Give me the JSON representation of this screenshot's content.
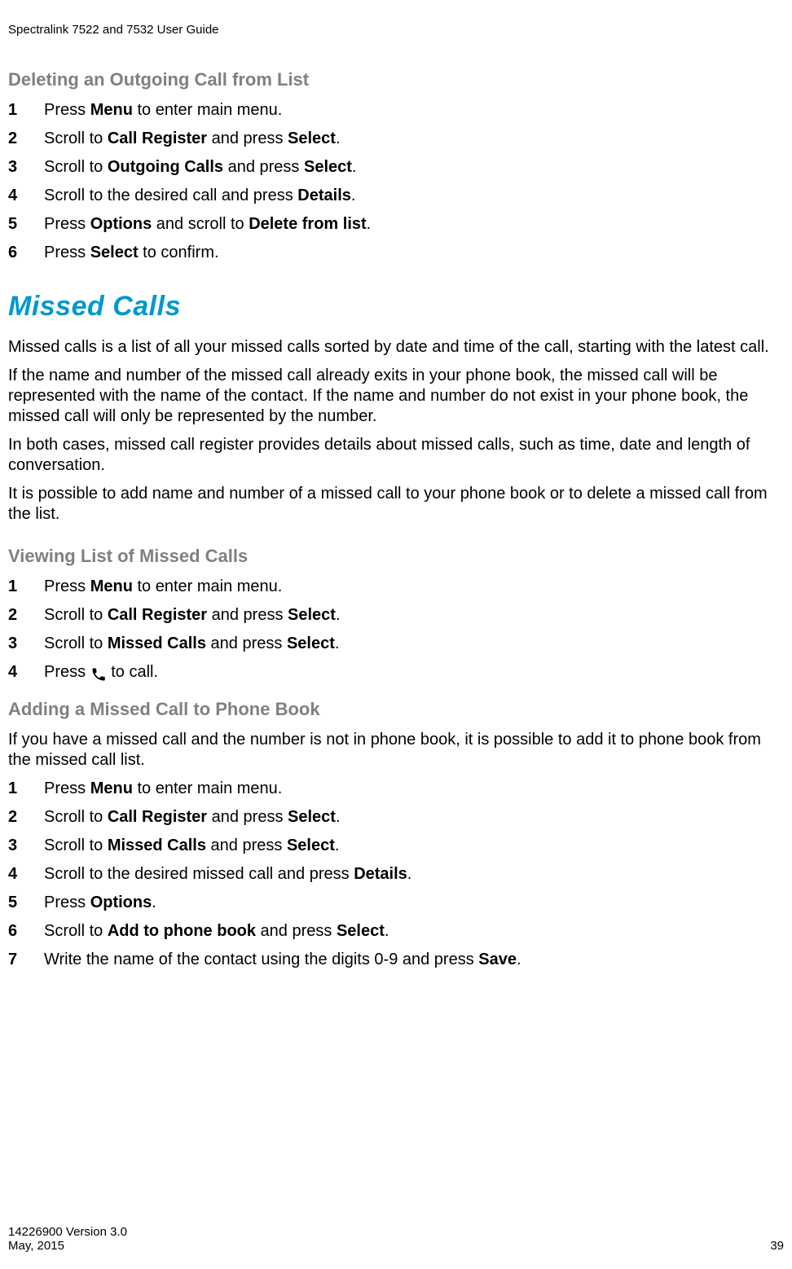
{
  "header": {
    "title": "Spectralink 7522 and 7532 User Guide"
  },
  "sections": {
    "delete_outgoing": {
      "heading": "Deleting an Outgoing Call from List",
      "steps": [
        {
          "pre": "Press ",
          "b1": "Menu",
          "mid": " to enter main menu.",
          "b2": "",
          "post": ""
        },
        {
          "pre": "Scroll to ",
          "b1": "Call Register",
          "mid": " and press ",
          "b2": "Select",
          "post": "."
        },
        {
          "pre": "Scroll to ",
          "b1": "Outgoing Calls",
          "mid": " and press ",
          "b2": "Select",
          "post": "."
        },
        {
          "pre": "Scroll to the desired call and press ",
          "b1": "Details",
          "mid": ".",
          "b2": "",
          "post": ""
        },
        {
          "pre": "Press ",
          "b1": "Options",
          "mid": " and scroll to ",
          "b2": "Delete from list",
          "post": "."
        },
        {
          "pre": "Press ",
          "b1": "Select",
          "mid": " to confirm.",
          "b2": "",
          "post": ""
        }
      ]
    },
    "missed_calls": {
      "chapter": "Missed Calls",
      "para1": "Missed calls is a list of all your missed calls sorted by date and time of the call, starting with the latest call.",
      "para2": "If the name and number of the missed call already exits in your phone book, the missed call will be represented with the name of the contact. If the name and number do not exist in your phone book, the missed call will only be represented by the number.",
      "para3": "In both cases, missed call register provides details about missed calls, such as time, date and length of conversation.",
      "para4": "It is possible to add name and number of a missed call to your phone book or to delete a missed call from the list."
    },
    "view_missed": {
      "heading": "Viewing List of Missed Calls",
      "steps": [
        {
          "pre": "Press ",
          "b1": "Menu",
          "mid": " to enter main menu.",
          "b2": "",
          "post": ""
        },
        {
          "pre": "Scroll to ",
          "b1": "Call Register",
          "mid": " and press ",
          "b2": "Select",
          "post": "."
        },
        {
          "pre": "Scroll to ",
          "b1": "Missed Calls",
          "mid": " and press ",
          "b2": "Select",
          "post": "."
        }
      ],
      "step4_pre": "Press ",
      "step4_post": " to call."
    },
    "add_missed": {
      "heading": "Adding a Missed Call to Phone Book",
      "intro": "If you have a missed call and the number is not in phone book, it is possible to add it to phone book from the missed call list.",
      "steps": [
        {
          "pre": "Press ",
          "b1": "Menu",
          "mid": " to enter main menu.",
          "b2": "",
          "post": ""
        },
        {
          "pre": "Scroll to ",
          "b1": "Call Register",
          "mid": " and press ",
          "b2": "Select",
          "post": "."
        },
        {
          "pre": "Scroll to ",
          "b1": "Missed Calls",
          "mid": " and press ",
          "b2": "Select",
          "post": "."
        },
        {
          "pre": "Scroll to the desired missed call and press ",
          "b1": "Details",
          "mid": ".",
          "b2": "",
          "post": ""
        },
        {
          "pre": "Press ",
          "b1": "Options",
          "mid": ".",
          "b2": "",
          "post": ""
        },
        {
          "pre": "Scroll to ",
          "b1": "Add to phone book",
          "mid": " and press ",
          "b2": "Select",
          "post": "."
        },
        {
          "pre": "Write the name of the contact using the digits 0-9 and press ",
          "b1": "Save",
          "mid": ".",
          "b2": "",
          "post": ""
        }
      ]
    }
  },
  "footer": {
    "line1": "14226900 Version 3.0",
    "line2_left": "May, 2015",
    "line2_right": "39"
  },
  "icons": {
    "call": "call-icon"
  }
}
